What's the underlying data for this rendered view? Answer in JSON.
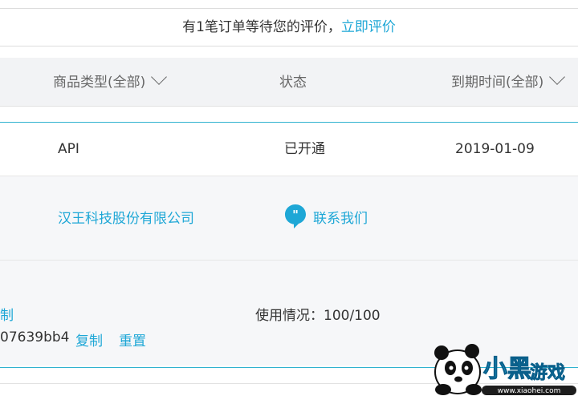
{
  "notice": {
    "text": "有1笔订单等待您的评价，",
    "link": "立即评价"
  },
  "table_header": {
    "product_type": "商品类型(全部)",
    "status": "状态",
    "expire": "到期时间(全部)"
  },
  "order": {
    "product": "API",
    "status": "已开通",
    "expire_date": "2019-01-09",
    "company": "汉王科技股份有限公司",
    "contact": "联系我们",
    "copy_partial": "制",
    "key_partial": "07639bb4",
    "copy": "复制",
    "reset": "重置",
    "usage": "使用情况：100/100"
  },
  "watermark": {
    "brand": "小黑游戏",
    "site": "www.xiaohei.com"
  },
  "colors": {
    "accent": "#1ea7d6",
    "card_border": "#2fb2cf"
  }
}
